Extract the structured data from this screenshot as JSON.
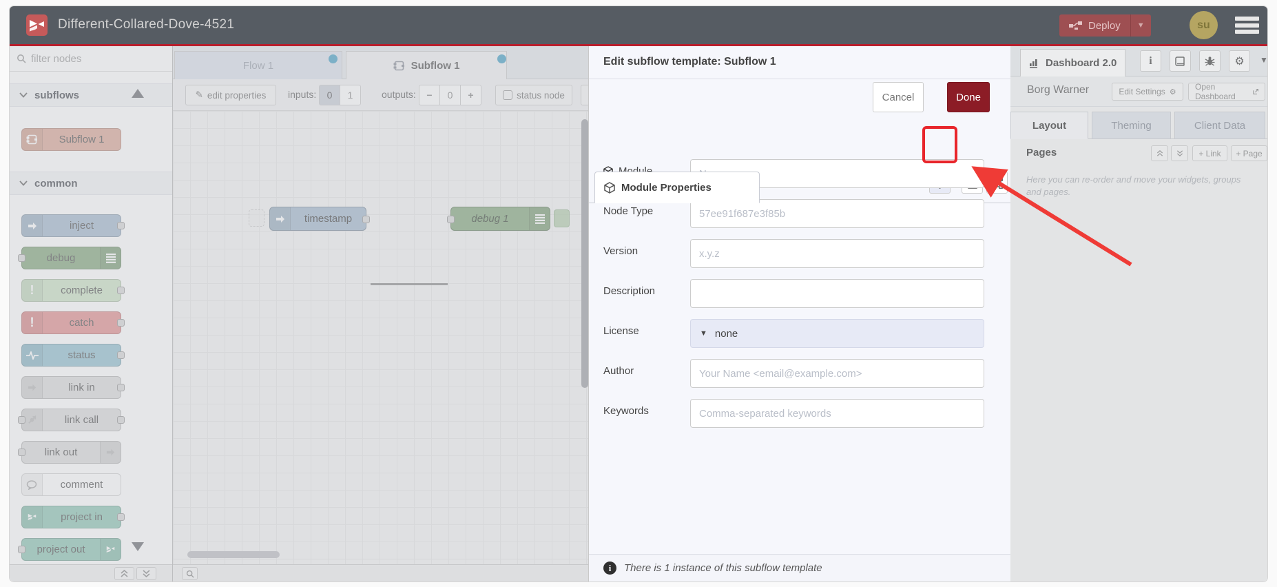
{
  "header": {
    "title": "Different-Collared-Dove-4521",
    "deploy_label": "Deploy",
    "avatar_initials": "su"
  },
  "palette": {
    "filter_placeholder": "filter nodes",
    "categories": [
      {
        "label": "subflows",
        "nodes": [
          {
            "label": "Subflow 1",
            "color": "#ddaa99"
          }
        ]
      },
      {
        "label": "common",
        "nodes": [
          {
            "label": "inject",
            "color": "#a6bbcf"
          },
          {
            "label": "debug",
            "color": "#87a980"
          },
          {
            "label": "complete",
            "color": "#cde4c7"
          },
          {
            "label": "catch",
            "color": "#e49191"
          },
          {
            "label": "status",
            "color": "#94c1d0"
          },
          {
            "label": "link in",
            "color": "#dddddd"
          },
          {
            "label": "link call",
            "color": "#dddddd"
          },
          {
            "label": "link out",
            "color": "#dddddd"
          },
          {
            "label": "comment",
            "color": "#ffffff"
          },
          {
            "label": "project in",
            "color": "#8fc7b5"
          },
          {
            "label": "project out",
            "color": "#8fc7b5"
          }
        ]
      }
    ]
  },
  "workspace": {
    "tabs": [
      {
        "label": "Flow 1",
        "active": false
      },
      {
        "label": "Subflow 1",
        "active": true
      }
    ],
    "toolbar": {
      "edit_properties_label": "edit properties",
      "inputs_label": "inputs:",
      "inputs_options": [
        "0",
        "1"
      ],
      "inputs_selected": "0",
      "outputs_label": "outputs:",
      "outputs_minus": "−",
      "outputs_value": "0",
      "outputs_plus": "+",
      "status_node_label": "status node"
    },
    "canvas_nodes": [
      {
        "label": "timestamp"
      },
      {
        "label": "debug 1"
      }
    ]
  },
  "dialog": {
    "title": "Edit subflow template: Subflow 1",
    "cancel_label": "Cancel",
    "done_label": "Done",
    "tab_label": "Module Properties",
    "fields": [
      {
        "label": "Module",
        "placeholder": "Name"
      },
      {
        "label": "Node Type",
        "placeholder": "57ee91f687e3f85b"
      },
      {
        "label": "Version",
        "placeholder": "x.y.z"
      },
      {
        "label": "Description",
        "placeholder": ""
      },
      {
        "label": "License",
        "value": "none"
      },
      {
        "label": "Author",
        "placeholder": "Your Name <email@example.com>"
      },
      {
        "label": "Keywords",
        "placeholder": "Comma-separated keywords"
      }
    ],
    "footer_text": "There is 1 instance of this subflow template"
  },
  "sidebar": {
    "tab_label": "Dashboard 2.0",
    "project_name": "Borg Warner",
    "edit_settings_label": "Edit Settings",
    "open_dashboard_label": "Open Dashboard",
    "tabs": [
      "Layout",
      "Theming",
      "Client Data"
    ],
    "pages_label": "Pages",
    "link_button_label": "+ Link",
    "page_button_label": "+ Page",
    "help_text": "Here you can re-order and move your widgets, groups and pages."
  },
  "colors": {
    "header_bg": "#565c63",
    "deploy_red": "#9e4f52",
    "accent_red_line": "#b81f2d",
    "done_button": "#8c1c26",
    "annotation_red": "#e8252b",
    "tab_dot_blue": "#4ba2c6"
  }
}
